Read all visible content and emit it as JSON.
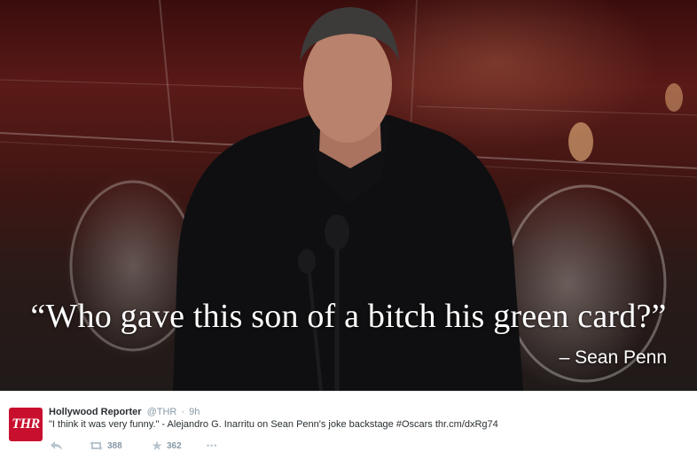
{
  "photo": {
    "quote": "“Who gave this son of a bitch his green card?”",
    "attribution": "– Sean Penn"
  },
  "tweet": {
    "avatar_text": "THR",
    "name": "Hollywood Reporter",
    "handle": "@THR",
    "separator": "·",
    "time": "9h",
    "text": "\"I think it was very funny.\" - Alejandro G. Inarritu on Sean Penn's joke backstage #Oscars thr.cm/dxRg74",
    "retweet_count": "388",
    "favorite_count": "362",
    "more_label": "•••"
  },
  "icons": {
    "reply": "reply-icon",
    "retweet": "retweet-icon",
    "favorite": "star-icon",
    "more": "more-icon"
  },
  "colors": {
    "avatar_bg": "#c8102e",
    "meta_gray": "#8899a6",
    "text_dark": "#292f33"
  }
}
